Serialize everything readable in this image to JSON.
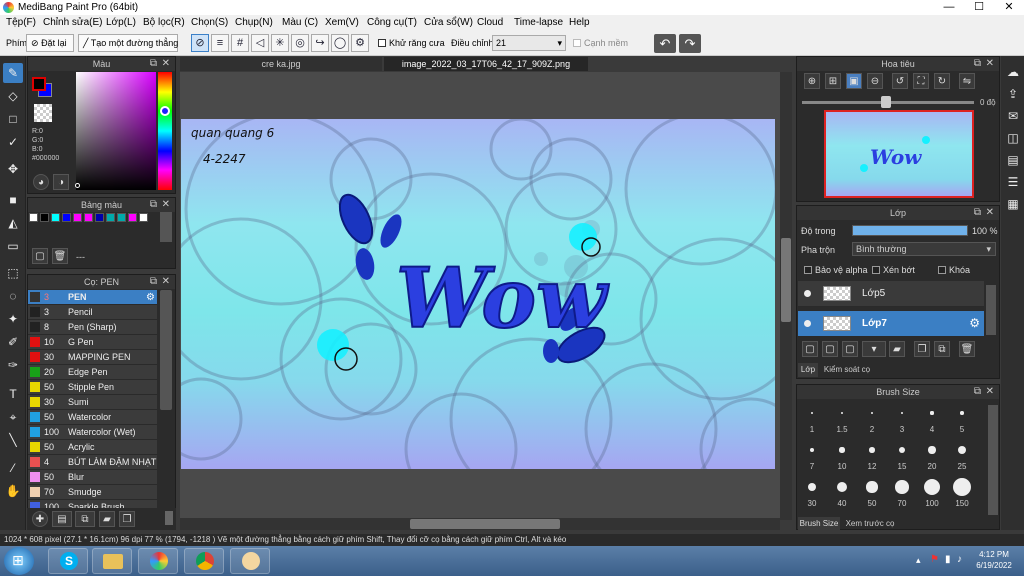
{
  "window": {
    "title": "MediBang Paint Pro (64bit)",
    "min": "—",
    "max": "☐",
    "close": "✕"
  },
  "menu": [
    "Tệp(F)",
    "Chỉnh sửa(E)",
    "Lớp(L)",
    "Bộ lọc(R)",
    "Chọn(S)",
    "Chụp(N)",
    "Màu (C)",
    "Xem(V)",
    "Công cụ(T)",
    "Cửa sổ(W)",
    "Cloud",
    "Time-lapse",
    "Help"
  ],
  "toolbar": {
    "brush_label": "Phím",
    "reset_label": "Đặt lại",
    "line_label": "Tạo một đường thẳng",
    "antialias_label": "Khử răng cưa",
    "adjust_label": "Điều chỉnh",
    "adjust_value": "21",
    "smooth_label": "Cạnh mềm"
  },
  "tabs": [
    "cre ka.jpg",
    "image_2022_03_17T06_42_17_909Z.png"
  ],
  "color_panel": {
    "title": "Màu",
    "r": "R:0",
    "g": "G:0",
    "b": "B:0",
    "hex": "#000000",
    "primary_color": "#000000",
    "secondary_color": "#0000ff"
  },
  "palette_panel": {
    "title": "Bảng màu",
    "swatches": [
      "#ffffff",
      "#000000",
      "#00ffff",
      "#0000ff",
      "#ff00ff",
      "#ff00ff",
      "#0000aa",
      "#00aaaa",
      "#00aaaa",
      "#ff00ff",
      "#ffffff"
    ],
    "name": "---"
  },
  "brush_panel": {
    "title": "Cọ: PEN",
    "brushes": [
      {
        "size": "3",
        "name": "PEN",
        "color": "#333333"
      },
      {
        "size": "3",
        "name": "Pencil",
        "color": "#222222"
      },
      {
        "size": "8",
        "name": "Pen (Sharp)",
        "color": "#222222"
      },
      {
        "size": "10",
        "name": "G Pen",
        "color": "#e01010"
      },
      {
        "size": "30",
        "name": "MAPPING PEN",
        "color": "#e01010"
      },
      {
        "size": "20",
        "name": "Edge Pen",
        "color": "#18a018"
      },
      {
        "size": "50",
        "name": "Stipple Pen",
        "color": "#e8d800"
      },
      {
        "size": "30",
        "name": "Sumi",
        "color": "#e8d800"
      },
      {
        "size": "50",
        "name": "Watercolor",
        "color": "#20a0e0"
      },
      {
        "size": "100",
        "name": "Watercolor (Wet)",
        "color": "#20a0e0"
      },
      {
        "size": "50",
        "name": "Acrylic",
        "color": "#e8d800"
      },
      {
        "size": "4",
        "name": "BÚT LÀM ĐẬM NHẠT",
        "color": "#e85050"
      },
      {
        "size": "50",
        "name": "Blur",
        "color": "#f090f0"
      },
      {
        "size": "70",
        "name": "Smudge",
        "color": "#f0d0b0"
      },
      {
        "size": "100",
        "name": "Sparkle Brush",
        "color": "#4060e0"
      }
    ]
  },
  "canvas_text": {
    "line1": "quan quang 6",
    "line2": "4-2247",
    "word": "Wow"
  },
  "navigator": {
    "title": "Hoa tiêu",
    "angle": "0 độ"
  },
  "layer_panel": {
    "title": "Lớp",
    "opacity_label": "Độ trong",
    "opacity_value": "100 %",
    "opacity": 1.0,
    "blend_label": "Pha trộn",
    "blend_value": "Bình thường",
    "protect_alpha": "Bảo vệ alpha",
    "clip": "Xén bớt",
    "lock": "Khóa",
    "layers": [
      "Lớp5",
      "Lớp7"
    ],
    "tab_layer": "Lớp",
    "tab_brush_control": "Kiểm soát cọ"
  },
  "brush_size_panel": {
    "title": "Brush Size",
    "sizes": [
      "1",
      "1.5",
      "2",
      "3",
      "4",
      "5",
      "7",
      "10",
      "12",
      "15",
      "20",
      "25",
      "30",
      "40",
      "50",
      "70",
      "100",
      "150"
    ],
    "tab_size": "Brush Size",
    "tab_preview": "Xem trước cọ"
  },
  "status": "1024 * 608 pixel   (27.1 * 16.1cm)   96 dpi   77 %   (1794, -1218 )   Vẽ một đường thẳng bằng cách giữ phím Shift, Thay đổi cỡ cọ bằng cách giữ phím Ctrl, Alt và kéo",
  "taskbar": {
    "time": "4:12 PM",
    "date": "6/19/2022"
  }
}
